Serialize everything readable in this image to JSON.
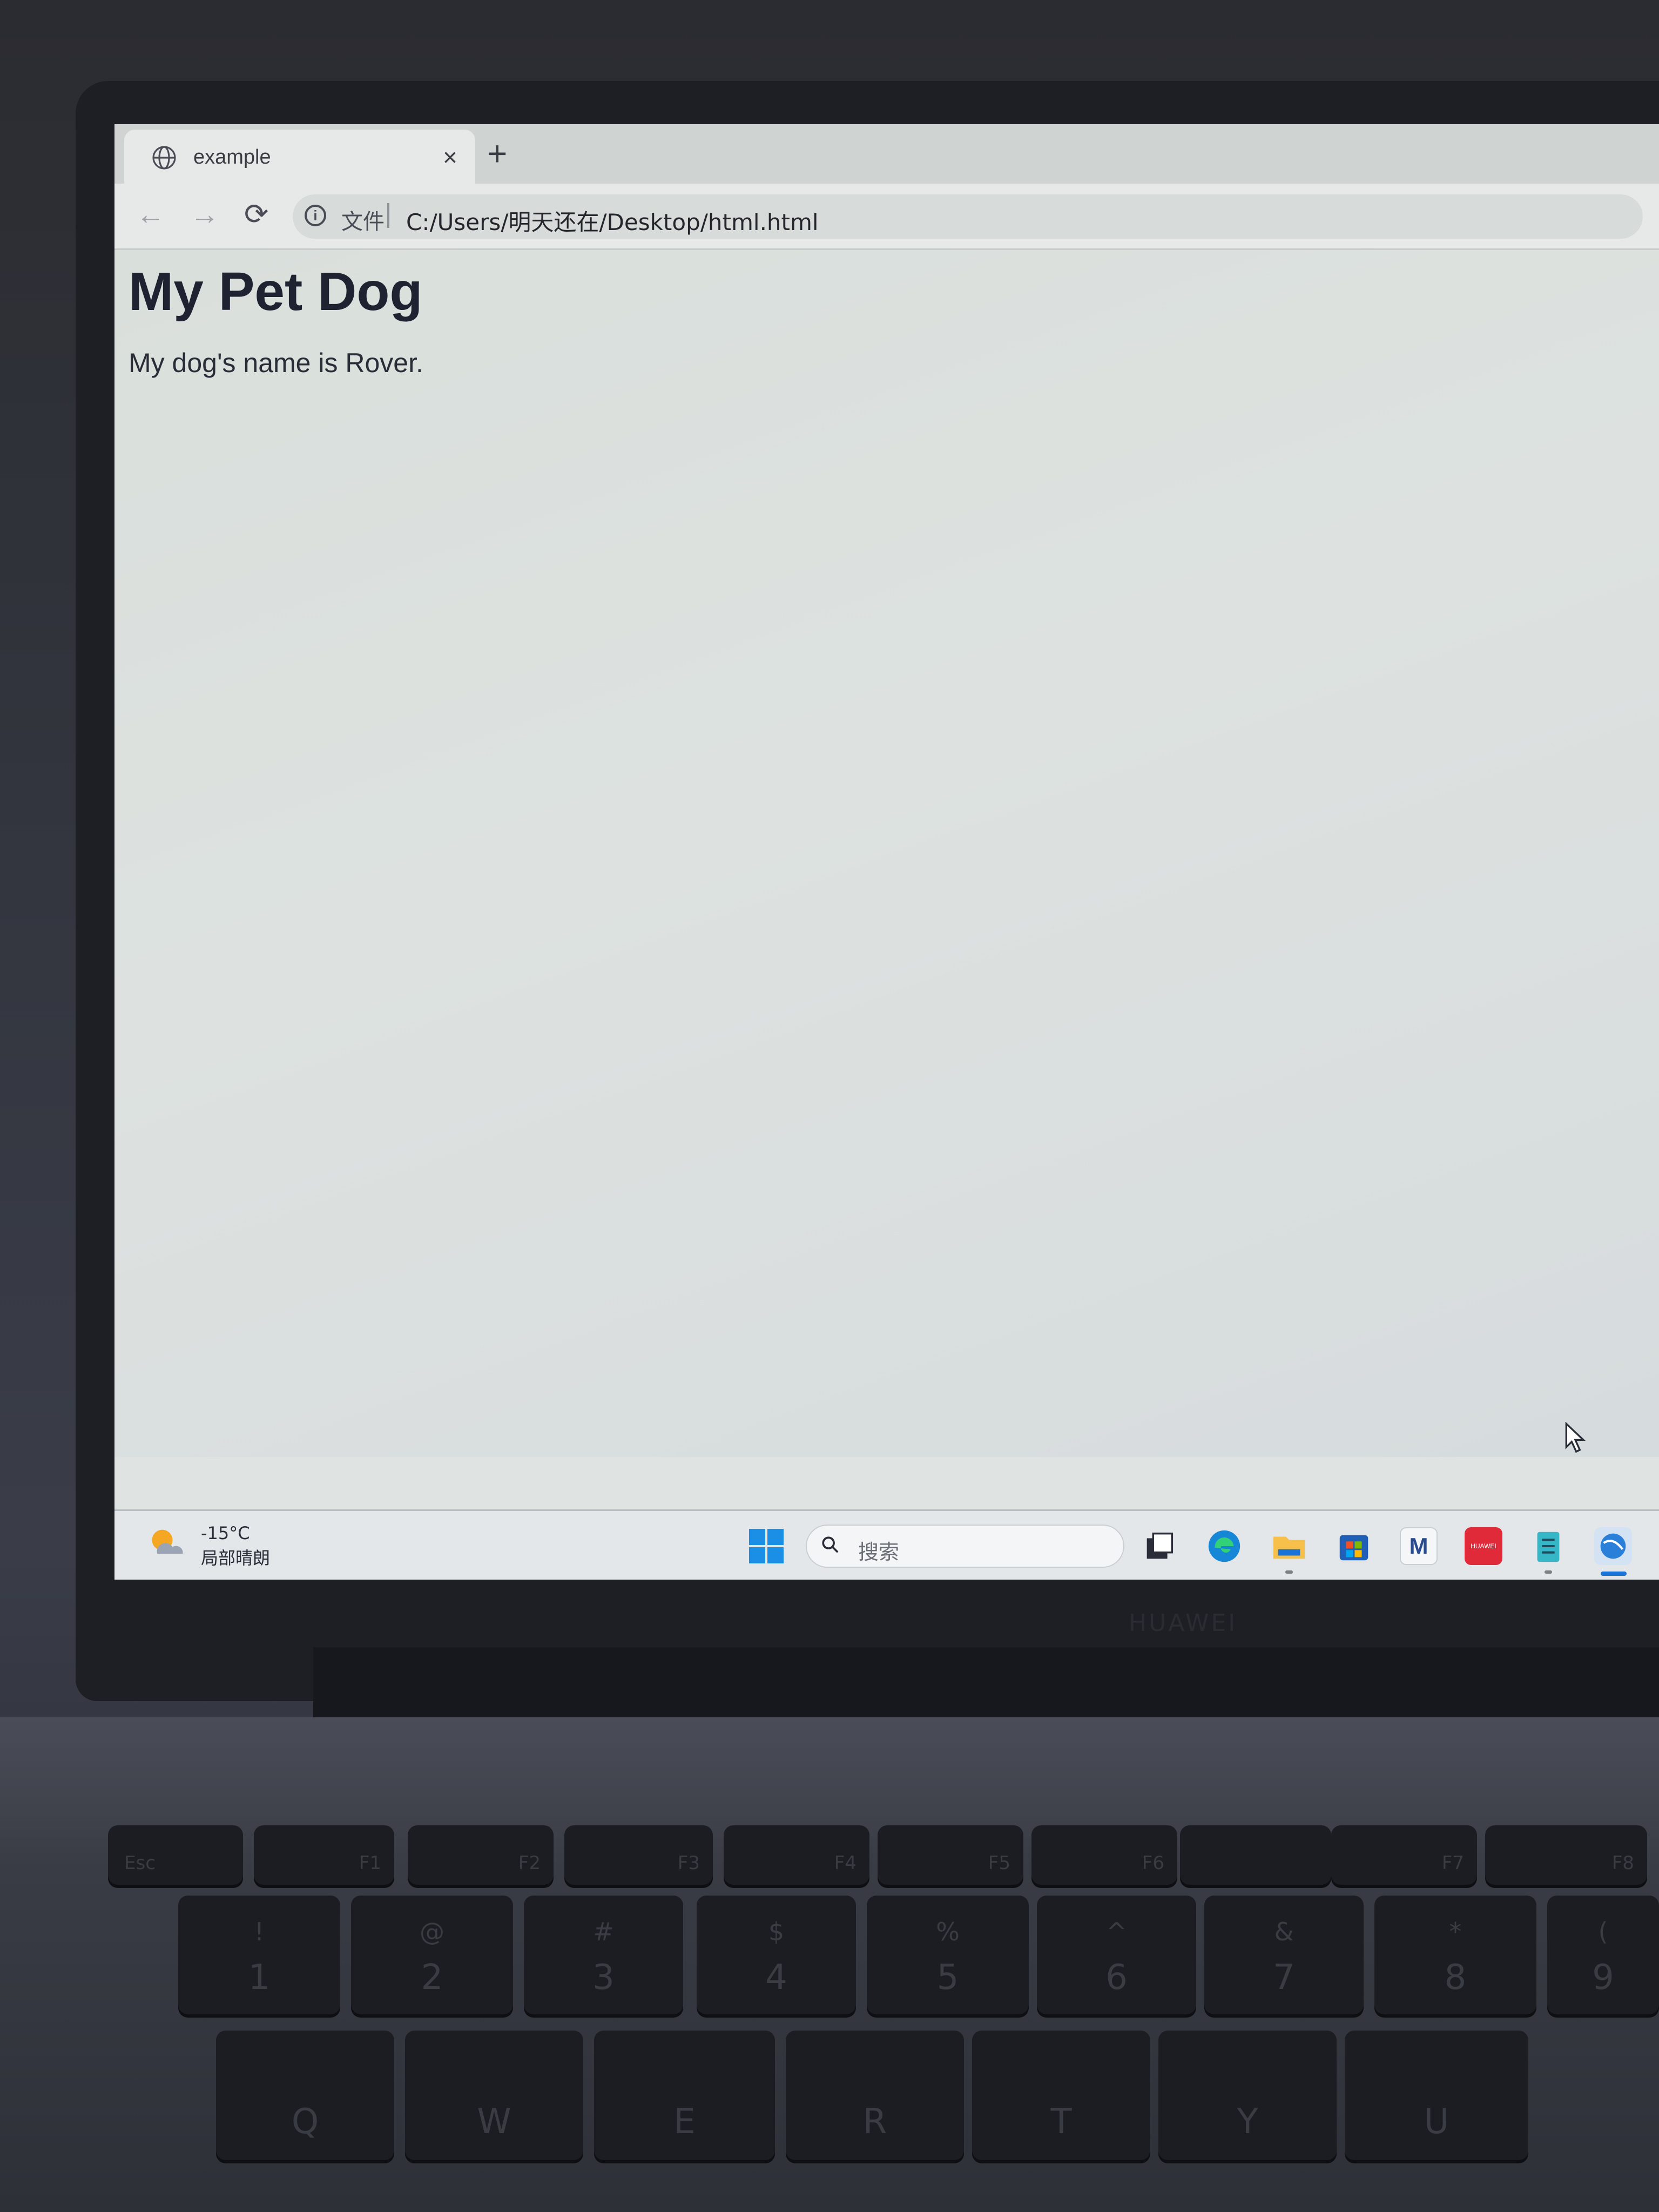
{
  "browser": {
    "tab": {
      "title": "example",
      "icon": "globe-icon",
      "close_label": "×"
    },
    "new_tab_label": "+",
    "nav": {
      "back": "←",
      "forward": "→",
      "reload": "⟳"
    },
    "address_bar": {
      "info_symbol": "i",
      "scheme_label": "文件",
      "url": "C:/Users/明天还在/Desktop/html.html"
    }
  },
  "page": {
    "heading": "My Pet Dog",
    "paragraph": "My dog's name is Rover."
  },
  "taskbar": {
    "weather": {
      "temperature": "-15°C",
      "condition": "局部晴朗"
    },
    "search": {
      "placeholder": "搜索"
    },
    "apps": [
      {
        "name": "task-view-icon"
      },
      {
        "name": "edge-browser-icon"
      },
      {
        "name": "file-explorer-icon"
      },
      {
        "name": "microsoft-store-icon"
      },
      {
        "name": "m-app-icon",
        "label": "M"
      },
      {
        "name": "huawei-appgallery-icon",
        "label": "HUAWEI"
      },
      {
        "name": "notepad-icon"
      },
      {
        "name": "active-browser-icon"
      }
    ]
  },
  "keyboard": {
    "function_row": [
      "Esc",
      "F1",
      "F2",
      "F3",
      "F4",
      "F5",
      "F6",
      "F7",
      "F8"
    ],
    "number_row": [
      {
        "top": "!",
        "main": "1"
      },
      {
        "top": "@",
        "main": "2"
      },
      {
        "top": "#",
        "main": "3"
      },
      {
        "top": "$",
        "main": "4"
      },
      {
        "top": "%",
        "main": "5"
      },
      {
        "top": "^",
        "main": "6"
      },
      {
        "top": "&",
        "main": "7"
      },
      {
        "top": "*",
        "main": "8"
      },
      {
        "top": "(",
        "main": "9"
      }
    ],
    "letter_row": [
      "Q",
      "W",
      "E",
      "R",
      "T",
      "Y",
      "U"
    ]
  },
  "colors": {
    "page_heading": "#1f2230",
    "taskbar_accent": "#1a73d9",
    "start_button": "#1b8fe6",
    "huawei_red": "#e02a3a"
  }
}
